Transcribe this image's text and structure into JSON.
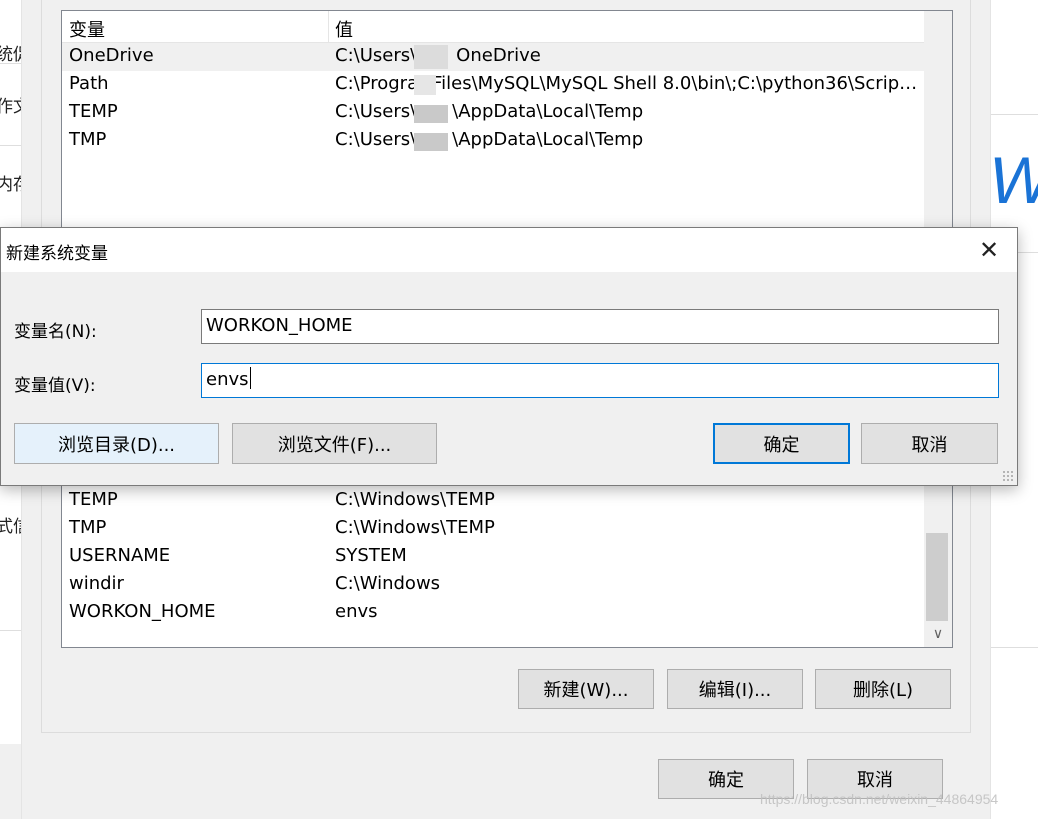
{
  "background": {
    "left_labels": [
      "统促",
      "作文",
      "内存",
      "式信"
    ],
    "right_glyph": "W"
  },
  "env_window": {
    "user_vars": {
      "headers": {
        "name": "变量",
        "value": "值"
      },
      "rows": [
        {
          "name": "OneDrive",
          "value": "C:\\Users\\",
          "value_suffix": "OneDrive"
        },
        {
          "name": "Path",
          "value": "C:\\Progra",
          "value_suffix": "Files\\MySQL\\MySQL Shell 8.0\\bin\\;C:\\python36\\Script..."
        },
        {
          "name": "TEMP",
          "value": "C:\\Users\\",
          "value_suffix": "\\AppData\\Local\\Temp"
        },
        {
          "name": "TMP",
          "value": "C:\\Users\\",
          "value_suffix": "\\AppData\\Local\\Temp"
        }
      ]
    },
    "sys_vars": {
      "rows": [
        {
          "name": "TEMP",
          "value": "C:\\Windows\\TEMP"
        },
        {
          "name": "TMP",
          "value": "C:\\Windows\\TEMP"
        },
        {
          "name": "USERNAME",
          "value": "SYSTEM"
        },
        {
          "name": "windir",
          "value": "C:\\Windows"
        },
        {
          "name": "WORKON_HOME",
          "value": "envs"
        }
      ]
    },
    "buttons": {
      "new": "新建(W)...",
      "edit": "编辑(I)...",
      "delete": "删除(L)",
      "ok": "确定",
      "cancel": "取消"
    }
  },
  "dialog": {
    "title": "新建系统变量",
    "name_label": "变量名(N):",
    "name_value": "WORKON_HOME",
    "value_label": "变量值(V):",
    "value_value": "envs",
    "browse_dir": "浏览目录(D)...",
    "browse_file": "浏览文件(F)...",
    "ok": "确定",
    "cancel": "取消"
  },
  "watermark": "https://blog.csdn.net/weixin_44864954",
  "colors": {
    "accent": "#0078d7",
    "window_bg": "#f0f0f0",
    "brand_blue": "#1a73d6"
  }
}
